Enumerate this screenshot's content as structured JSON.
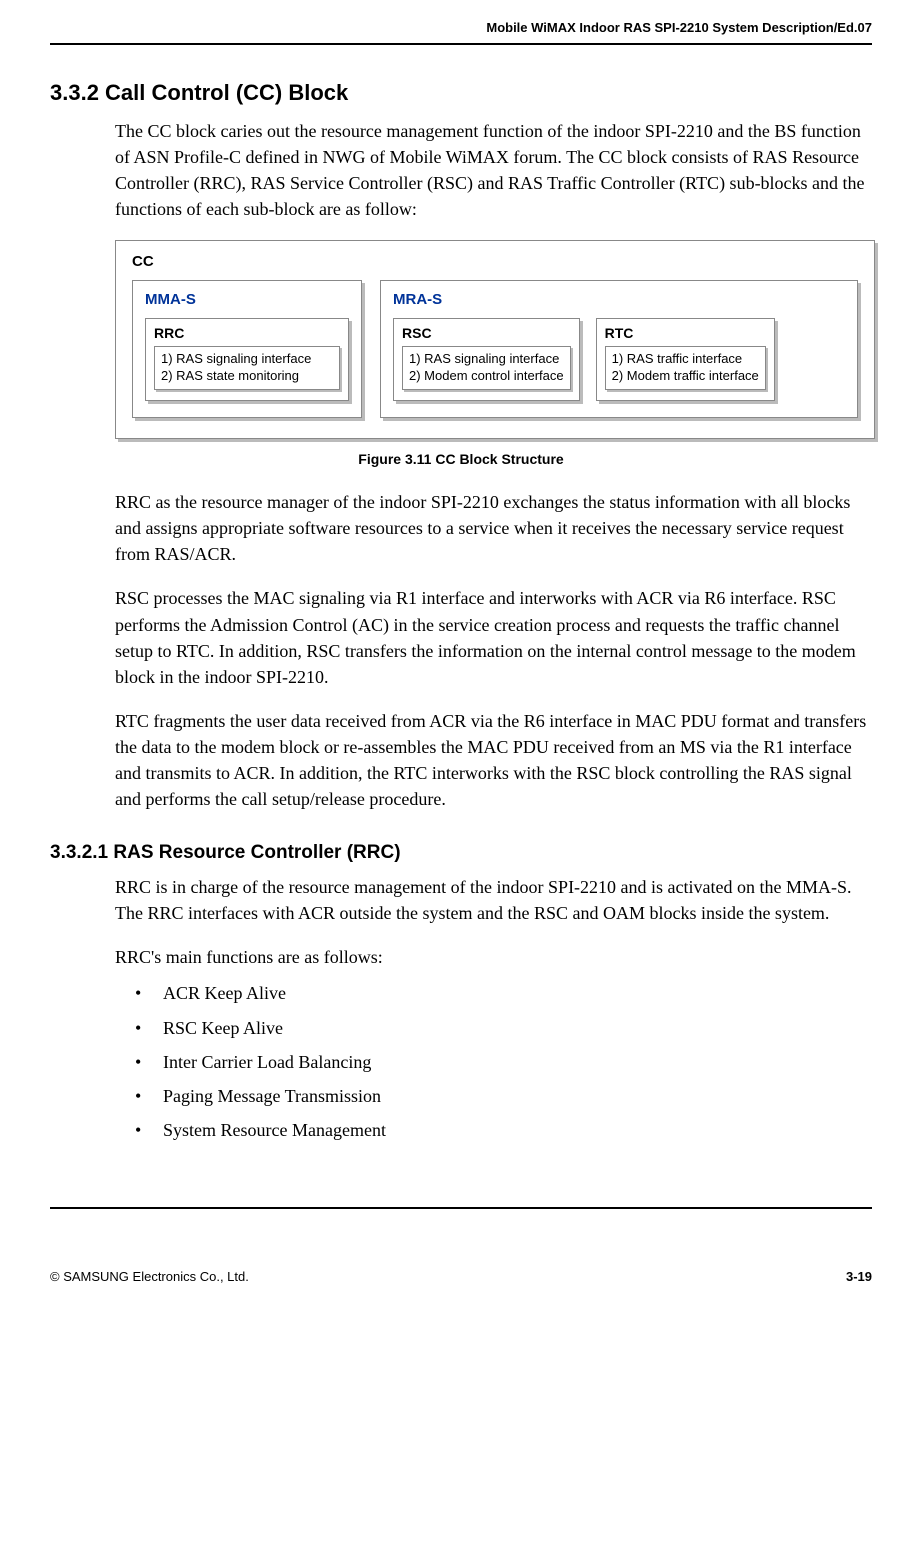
{
  "header": {
    "doc_title": "Mobile WiMAX Indoor RAS SPI-2210 System Description/Ed.07"
  },
  "section332": {
    "number_title": "3.3.2  Call Control (CC) Block",
    "para1": "The CC block caries out the resource management function of the indoor SPI-2210 and the BS function of ASN Profile-C defined in NWG of Mobile WiMAX forum. The CC block consists of RAS Resource Controller (RRC), RAS Service Controller (RSC) and RAS Traffic Controller (RTC) sub-blocks and the functions of each sub-block are as follow:"
  },
  "diagram": {
    "cc_label": "CC",
    "mma_label": "MMA-S",
    "mra_label": "MRA-S",
    "rrc": {
      "label": "RRC",
      "line1": "1) RAS signaling interface",
      "line2": "2) RAS state monitoring"
    },
    "rsc": {
      "label": "RSC",
      "line1": "1) RAS signaling interface",
      "line2": "2) Modem control interface"
    },
    "rtc": {
      "label": "RTC",
      "line1": "1) RAS traffic interface",
      "line2": "2) Modem traffic interface"
    }
  },
  "figure_caption": "Figure 3.11    CC Block Structure",
  "paras": {
    "p2": "RRC as the resource manager of the indoor SPI-2210 exchanges the status information with all blocks and assigns appropriate software resources to a service when it receives the necessary service request from RAS/ACR.",
    "p3": "RSC processes the MAC signaling via R1 interface and interworks with ACR via R6 interface. RSC performs the Admission Control (AC) in the service creation process and requests the traffic channel setup to RTC. In addition, RSC transfers the information on the internal control message to the modem block in the indoor SPI-2210.",
    "p4": "RTC fragments the user data received from ACR via the R6 interface in MAC PDU format and transfers the data to the modem block or re-assembles the MAC PDU received from an MS via the R1 interface and transmits to ACR. In addition, the RTC interworks with the RSC block controlling the RAS signal and performs the call setup/release procedure."
  },
  "section3321": {
    "number_title": "3.3.2.1  RAS Resource Controller (RRC)",
    "para1": "RRC is in charge of the resource management of the indoor SPI-2210 and is activated on the MMA-S. The RRC interfaces with ACR outside the system and the RSC and OAM blocks inside the system.",
    "list_intro": "RRC's main functions are as follows:",
    "items": {
      "i0": "ACR Keep Alive",
      "i1": "RSC Keep Alive",
      "i2": "Inter Carrier Load Balancing",
      "i3": "Paging Message Transmission",
      "i4": "System Resource Management"
    }
  },
  "footer": {
    "left": "© SAMSUNG Electronics Co., Ltd.",
    "right": "3-19"
  }
}
